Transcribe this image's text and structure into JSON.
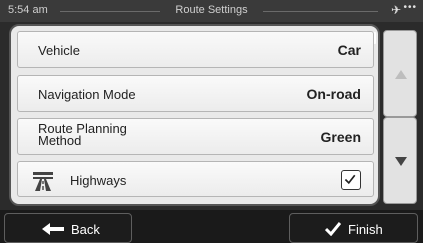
{
  "status_bar": {
    "time": "5:54 am",
    "title": "Route Settings",
    "gps_icon": "satellite-icon",
    "menu_icon": "dots-icon"
  },
  "settings": [
    {
      "label": "Vehicle",
      "value": "Car"
    },
    {
      "label": "Navigation Mode",
      "value": "On-road"
    },
    {
      "label": "Route Planning Method",
      "label_line1": "Route Planning",
      "label_line2": "Method",
      "value": "Green"
    },
    {
      "label": "Highways",
      "icon": "highway-icon",
      "checked": true
    }
  ],
  "scroll": {
    "up_icon": "arrow-up-icon",
    "down_icon": "arrow-down-icon"
  },
  "footer": {
    "back_label": "Back",
    "finish_label": "Finish"
  },
  "colors": {
    "background": "#2b2b2b",
    "panel": "#e9e9e9",
    "button": "#1c1c1c"
  }
}
